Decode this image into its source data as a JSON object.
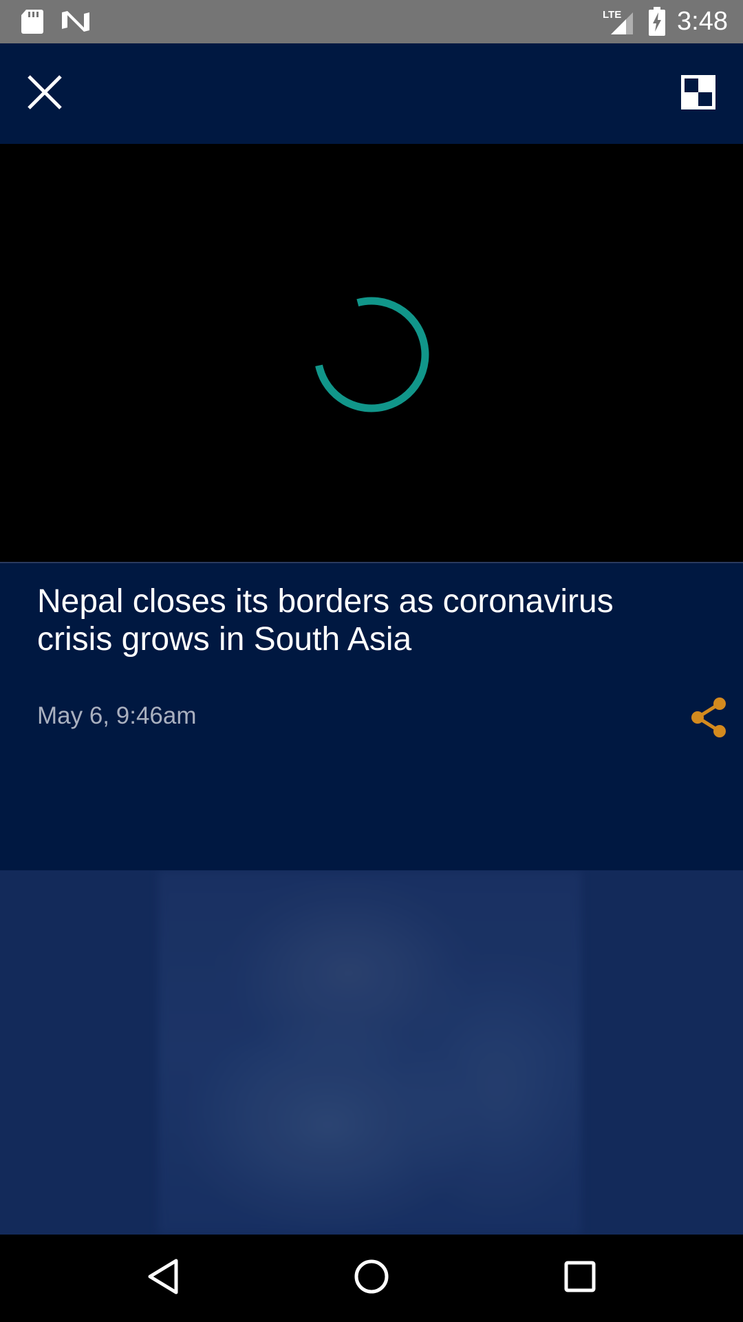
{
  "status_bar": {
    "time": "3:48",
    "icons": [
      "sd-card-icon",
      "n-notification-icon",
      "lte-signal-icon",
      "battery-charging-icon"
    ]
  },
  "toolbar": {
    "close_icon": "close-icon",
    "pip_icon": "picture-in-picture-icon"
  },
  "video": {
    "state": "loading",
    "spinner_color": "#11968a"
  },
  "article": {
    "headline": "Nepal closes its borders as coronavirus crisis grows in South Asia",
    "timestamp": "May 6, 9:46am",
    "share_icon": "share-icon",
    "share_color": "#d48a1e"
  },
  "nav_bar": {
    "icons": [
      "back-icon",
      "home-icon",
      "recents-icon"
    ]
  },
  "colors": {
    "status_bar": "#757575",
    "header_bg": "#001841",
    "preview_bg": "#132a5a",
    "accent_teal": "#11968a",
    "accent_orange": "#d48a1e"
  }
}
